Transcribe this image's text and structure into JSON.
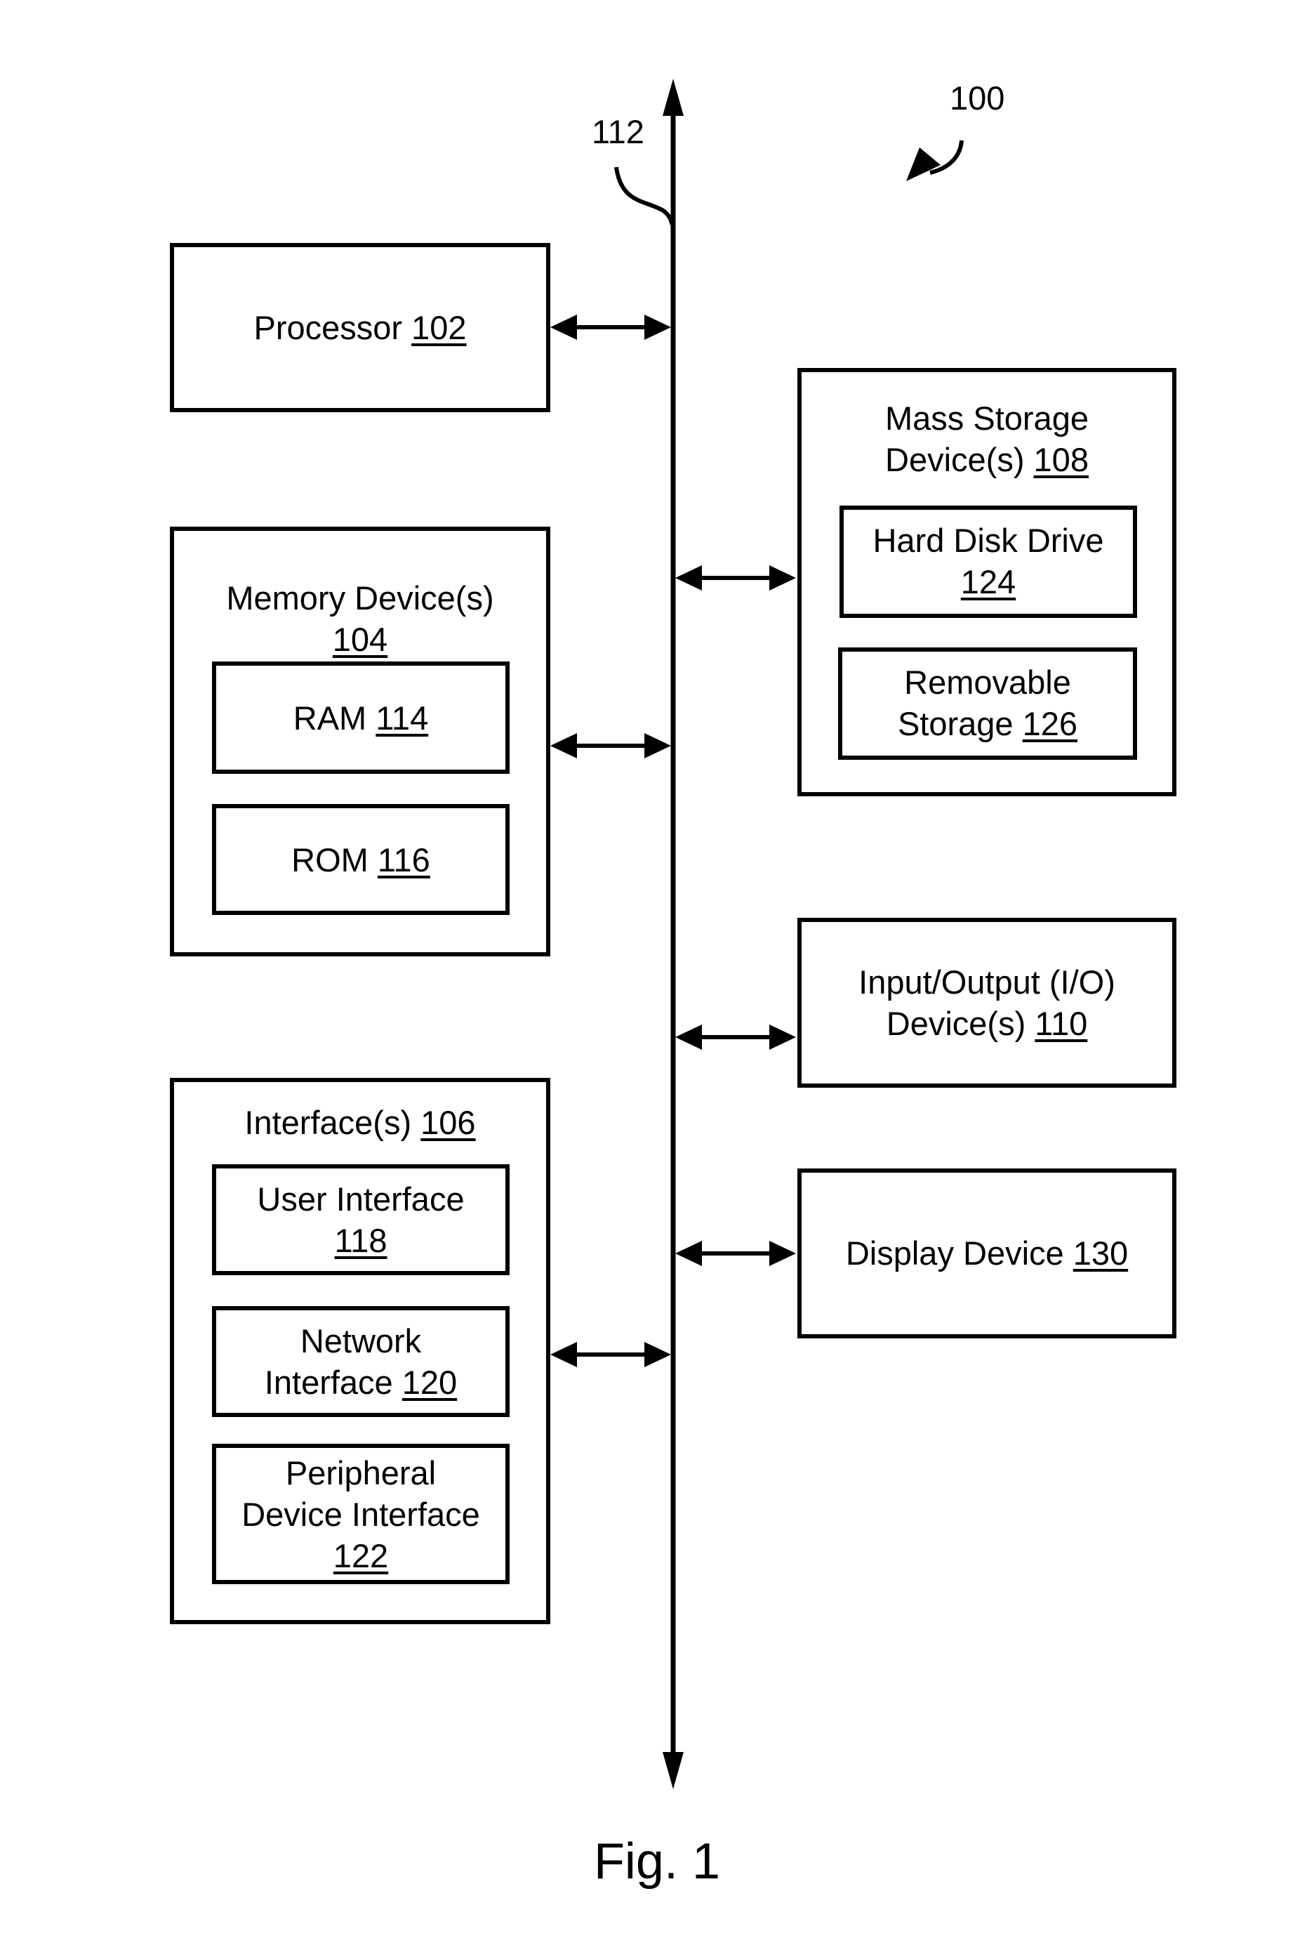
{
  "figure": {
    "caption": "Fig. 1",
    "system_ref": "100",
    "bus_ref": "112",
    "colors": {
      "line": "#000000",
      "background": "#ffffff"
    }
  },
  "blocks": {
    "processor": {
      "text": "Processor",
      "num": "102"
    },
    "memory": {
      "text": "Memory Device(s)",
      "num": "104",
      "children": {
        "ram": {
          "text": "RAM",
          "num": "114"
        },
        "rom": {
          "text": "ROM",
          "num": "116"
        }
      }
    },
    "interfaces": {
      "text": "Interface(s)",
      "num": "106",
      "children": {
        "user": {
          "line1": "User Interface",
          "num": "118"
        },
        "network": {
          "line1": "Network",
          "line2": "Interface",
          "num": "120"
        },
        "peripheral": {
          "line1": "Peripheral",
          "line2": "Device Interface",
          "num": "122"
        }
      }
    },
    "mass_storage": {
      "line1": "Mass Storage",
      "line2": "Device(s)",
      "num": "108",
      "children": {
        "hdd": {
          "line1": "Hard Disk Drive",
          "num": "124"
        },
        "removable": {
          "line1": "Removable",
          "line2": "Storage",
          "num": "126"
        }
      }
    },
    "io": {
      "line1": "Input/Output (I/O)",
      "line2": "Device(s)",
      "num": "110"
    },
    "display": {
      "text": "Display Device",
      "num": "130"
    }
  }
}
